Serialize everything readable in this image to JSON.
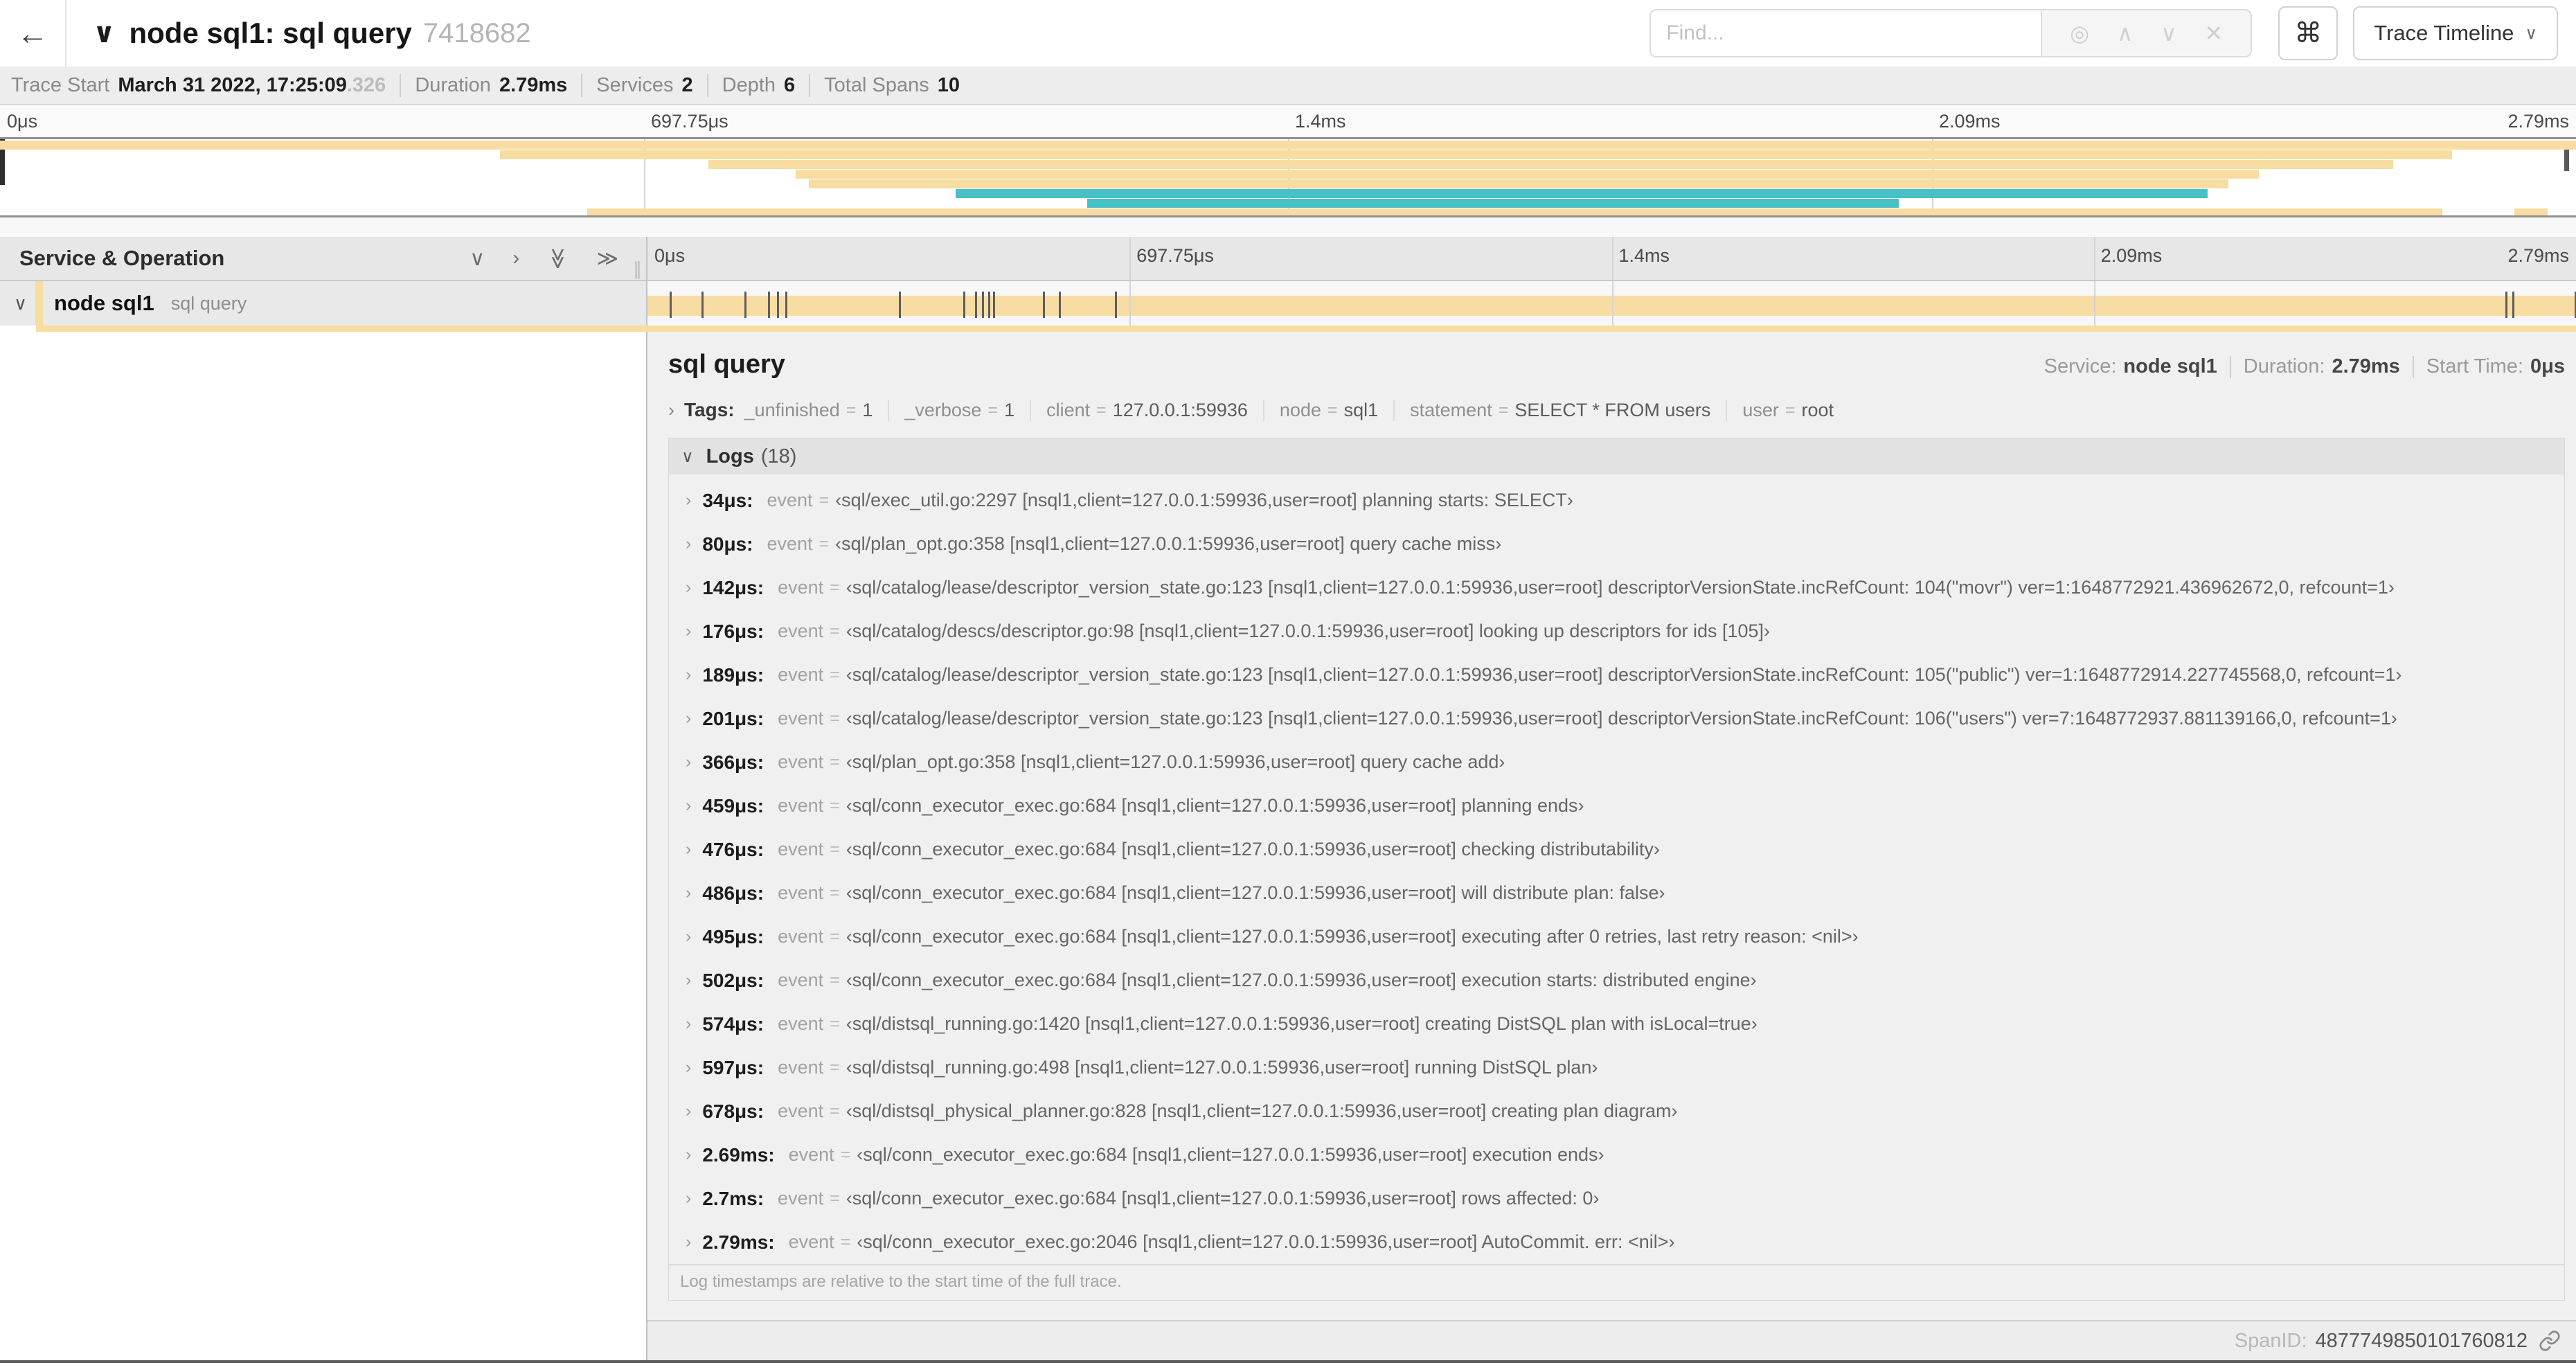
{
  "colors": {
    "beige": "#f7dda1",
    "teal": "#47c1c6"
  },
  "symbols": {
    "eq": "=",
    "chevron_right": "›",
    "chevron_down": "∨",
    "double_chevron": "≫"
  },
  "header": {
    "back_icon": "←",
    "collapse_icon": "∨",
    "title": "node sql1: sql query",
    "trace_id": "7418682",
    "find_placeholder": "Find...",
    "find_icons": {
      "target": "◎",
      "prev": "∧",
      "next": "∨",
      "clear": "✕"
    },
    "keyboard_button": "⌘",
    "view_select": "Trace Timeline",
    "view_caret": "∨"
  },
  "summary": {
    "items": [
      {
        "label": "Trace Start",
        "value": "March 31 2022, 17:25:09",
        "suffix": ".326"
      },
      {
        "label": "Duration",
        "value": "2.79ms",
        "suffix": ""
      },
      {
        "label": "Services",
        "value": "2",
        "suffix": ""
      },
      {
        "label": "Depth",
        "value": "6",
        "suffix": ""
      },
      {
        "label": "Total Spans",
        "value": "10",
        "suffix": ""
      }
    ]
  },
  "minimap": {
    "ticks": [
      "0μs",
      "697.75μs",
      "1.4ms",
      "2.09ms",
      "2.79ms"
    ],
    "spans": [
      {
        "row": 0,
        "start": 0,
        "end": 100,
        "color": "beige"
      },
      {
        "row": 1,
        "start": 19.4,
        "end": 95.2,
        "color": "beige"
      },
      {
        "row": 2,
        "start": 27.5,
        "end": 92.9,
        "color": "beige"
      },
      {
        "row": 3,
        "start": 30.9,
        "end": 87.7,
        "color": "beige"
      },
      {
        "row": 4,
        "start": 31.4,
        "end": 86.5,
        "color": "beige"
      },
      {
        "row": 5,
        "start": 37.1,
        "end": 85.7,
        "color": "teal"
      },
      {
        "row": 6,
        "start": 42.2,
        "end": 73.7,
        "color": "teal"
      },
      {
        "row": 7,
        "start": 22.8,
        "end": 94.8,
        "color": "beige"
      },
      {
        "row": 7,
        "start": 97.6,
        "end": 98.9,
        "color": "beige"
      }
    ]
  },
  "timeline": {
    "left_header": "Service & Operation",
    "collapse_icons": [
      "∨",
      "›",
      "≫",
      "≫"
    ],
    "ticks": [
      "0μs",
      "697.75μs",
      "1.4ms",
      "2.09ms",
      "2.79ms"
    ],
    "total_us": 2790
  },
  "row": {
    "chevron": "∨",
    "service": "node sql1",
    "operation": "sql query"
  },
  "detail": {
    "title": "sql query",
    "meta": [
      {
        "label": "Service:",
        "value": "node sql1"
      },
      {
        "label": "Duration:",
        "value": "2.79ms"
      },
      {
        "label": "Start Time:",
        "value": "0μs"
      }
    ],
    "tags_label": "Tags:",
    "tags": [
      {
        "key": "_unfinished",
        "value": "1"
      },
      {
        "key": "_verbose",
        "value": "1"
      },
      {
        "key": "client",
        "value": "127.0.0.1:59936"
      },
      {
        "key": "node",
        "value": "sql1"
      },
      {
        "key": "statement",
        "value": "SELECT * FROM users"
      },
      {
        "key": "user",
        "value": "root"
      }
    ],
    "logs_label": "Logs",
    "logs_count": "(18)",
    "logs": [
      {
        "t": "34μs:",
        "us": 34,
        "k": "event",
        "v": "‹sql/exec_util.go:2297 [nsql1,client=127.0.0.1:59936,user=root] planning starts: SELECT›"
      },
      {
        "t": "80μs:",
        "us": 80,
        "k": "event",
        "v": "‹sql/plan_opt.go:358 [nsql1,client=127.0.0.1:59936,user=root] query cache miss›"
      },
      {
        "t": "142μs:",
        "us": 142,
        "k": "event",
        "v": "‹sql/catalog/lease/descriptor_version_state.go:123 [nsql1,client=127.0.0.1:59936,user=root] descriptorVersionState.incRefCount: 104(\"movr\") ver=1:1648772921.436962672,0, refcount=1›"
      },
      {
        "t": "176μs:",
        "us": 176,
        "k": "event",
        "v": "‹sql/catalog/descs/descriptor.go:98 [nsql1,client=127.0.0.1:59936,user=root] looking up descriptors for ids [105]›"
      },
      {
        "t": "189μs:",
        "us": 189,
        "k": "event",
        "v": "‹sql/catalog/lease/descriptor_version_state.go:123 [nsql1,client=127.0.0.1:59936,user=root] descriptorVersionState.incRefCount: 105(\"public\") ver=1:1648772914.227745568,0, refcount=1›"
      },
      {
        "t": "201μs:",
        "us": 201,
        "k": "event",
        "v": "‹sql/catalog/lease/descriptor_version_state.go:123 [nsql1,client=127.0.0.1:59936,user=root] descriptorVersionState.incRefCount: 106(\"users\") ver=7:1648772937.881139166,0, refcount=1›"
      },
      {
        "t": "366μs:",
        "us": 366,
        "k": "event",
        "v": "‹sql/plan_opt.go:358 [nsql1,client=127.0.0.1:59936,user=root] query cache add›"
      },
      {
        "t": "459μs:",
        "us": 459,
        "k": "event",
        "v": "‹sql/conn_executor_exec.go:684 [nsql1,client=127.0.0.1:59936,user=root] planning ends›"
      },
      {
        "t": "476μs:",
        "us": 476,
        "k": "event",
        "v": "‹sql/conn_executor_exec.go:684 [nsql1,client=127.0.0.1:59936,user=root] checking distributability›"
      },
      {
        "t": "486μs:",
        "us": 486,
        "k": "event",
        "v": "‹sql/conn_executor_exec.go:684 [nsql1,client=127.0.0.1:59936,user=root] will distribute plan: false›"
      },
      {
        "t": "495μs:",
        "us": 495,
        "k": "event",
        "v": "‹sql/conn_executor_exec.go:684 [nsql1,client=127.0.0.1:59936,user=root] executing after 0 retries, last retry reason: <nil>›"
      },
      {
        "t": "502μs:",
        "us": 502,
        "k": "event",
        "v": "‹sql/conn_executor_exec.go:684 [nsql1,client=127.0.0.1:59936,user=root] execution starts: distributed engine›"
      },
      {
        "t": "574μs:",
        "us": 574,
        "k": "event",
        "v": "‹sql/distsql_running.go:1420 [nsql1,client=127.0.0.1:59936,user=root] creating DistSQL plan with isLocal=true›"
      },
      {
        "t": "597μs:",
        "us": 597,
        "k": "event",
        "v": "‹sql/distsql_running.go:498 [nsql1,client=127.0.0.1:59936,user=root] running DistSQL plan›"
      },
      {
        "t": "678μs:",
        "us": 678,
        "k": "event",
        "v": "‹sql/distsql_physical_planner.go:828 [nsql1,client=127.0.0.1:59936,user=root] creating plan diagram›"
      },
      {
        "t": "2.69ms:",
        "us": 2690,
        "k": "event",
        "v": "‹sql/conn_executor_exec.go:684 [nsql1,client=127.0.0.1:59936,user=root] execution ends›"
      },
      {
        "t": "2.7ms:",
        "us": 2700,
        "k": "event",
        "v": "‹sql/conn_executor_exec.go:684 [nsql1,client=127.0.0.1:59936,user=root] rows affected: 0›"
      },
      {
        "t": "2.79ms:",
        "us": 2790,
        "k": "event",
        "v": "‹sql/conn_executor_exec.go:2046 [nsql1,client=127.0.0.1:59936,user=root] AutoCommit. err: <nil>›"
      }
    ],
    "logs_note": "Log timestamps are relative to the start time of the full trace.",
    "spanid_label": "SpanID:",
    "spanid_value": "4877749850101760812"
  }
}
